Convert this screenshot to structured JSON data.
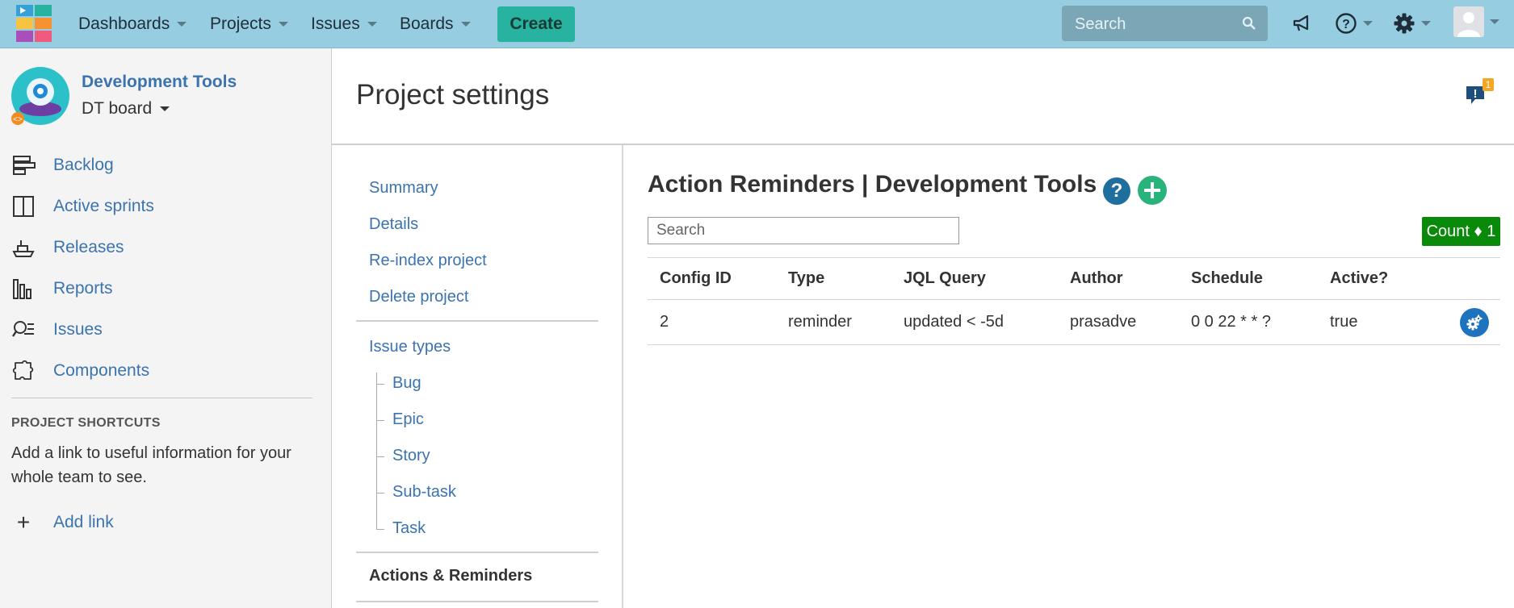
{
  "topbar": {
    "nav": [
      {
        "label": "Dashboards"
      },
      {
        "label": "Projects"
      },
      {
        "label": "Issues"
      },
      {
        "label": "Boards"
      }
    ],
    "create_label": "Create",
    "search_placeholder": "Search",
    "icons": [
      "megaphone-icon",
      "help-icon",
      "gear-icon",
      "user-avatar"
    ],
    "colors": {
      "bar": "#97cde0",
      "create": "#27b3a0"
    }
  },
  "sidebar": {
    "project_name": "Development Tools",
    "board_name": "DT board",
    "items": [
      {
        "label": "Backlog",
        "icon": "backlog-icon"
      },
      {
        "label": "Active sprints",
        "icon": "active-sprints-icon"
      },
      {
        "label": "Releases",
        "icon": "releases-icon"
      },
      {
        "label": "Reports",
        "icon": "reports-icon"
      },
      {
        "label": "Issues",
        "icon": "issues-icon"
      },
      {
        "label": "Components",
        "icon": "components-icon"
      }
    ],
    "shortcuts_heading": "PROJECT SHORTCUTS",
    "shortcuts_desc": "Add a link to useful information for your whole team to see.",
    "add_link_label": "Add link"
  },
  "header": {
    "title": "Project settings",
    "notification_count": "1"
  },
  "settings_nav": {
    "group1": [
      "Summary",
      "Details",
      "Re-index project",
      "Delete project"
    ],
    "issue_types_label": "Issue types",
    "issue_types": [
      "Bug",
      "Epic",
      "Story",
      "Sub-task",
      "Task"
    ],
    "active_label": "Actions & Reminders"
  },
  "main": {
    "heading": "Action Reminders | Development Tools",
    "search_placeholder": "Search",
    "count_label": "Count ♦ 1",
    "columns": [
      "Config ID",
      "Type",
      "JQL Query",
      "Author",
      "Schedule",
      "Active?"
    ],
    "rows": [
      {
        "config_id": "2",
        "type": "reminder",
        "jql": "updated < -5d",
        "author": "prasadve",
        "schedule": "0 0 22 * * ?",
        "active": "true"
      }
    ]
  }
}
